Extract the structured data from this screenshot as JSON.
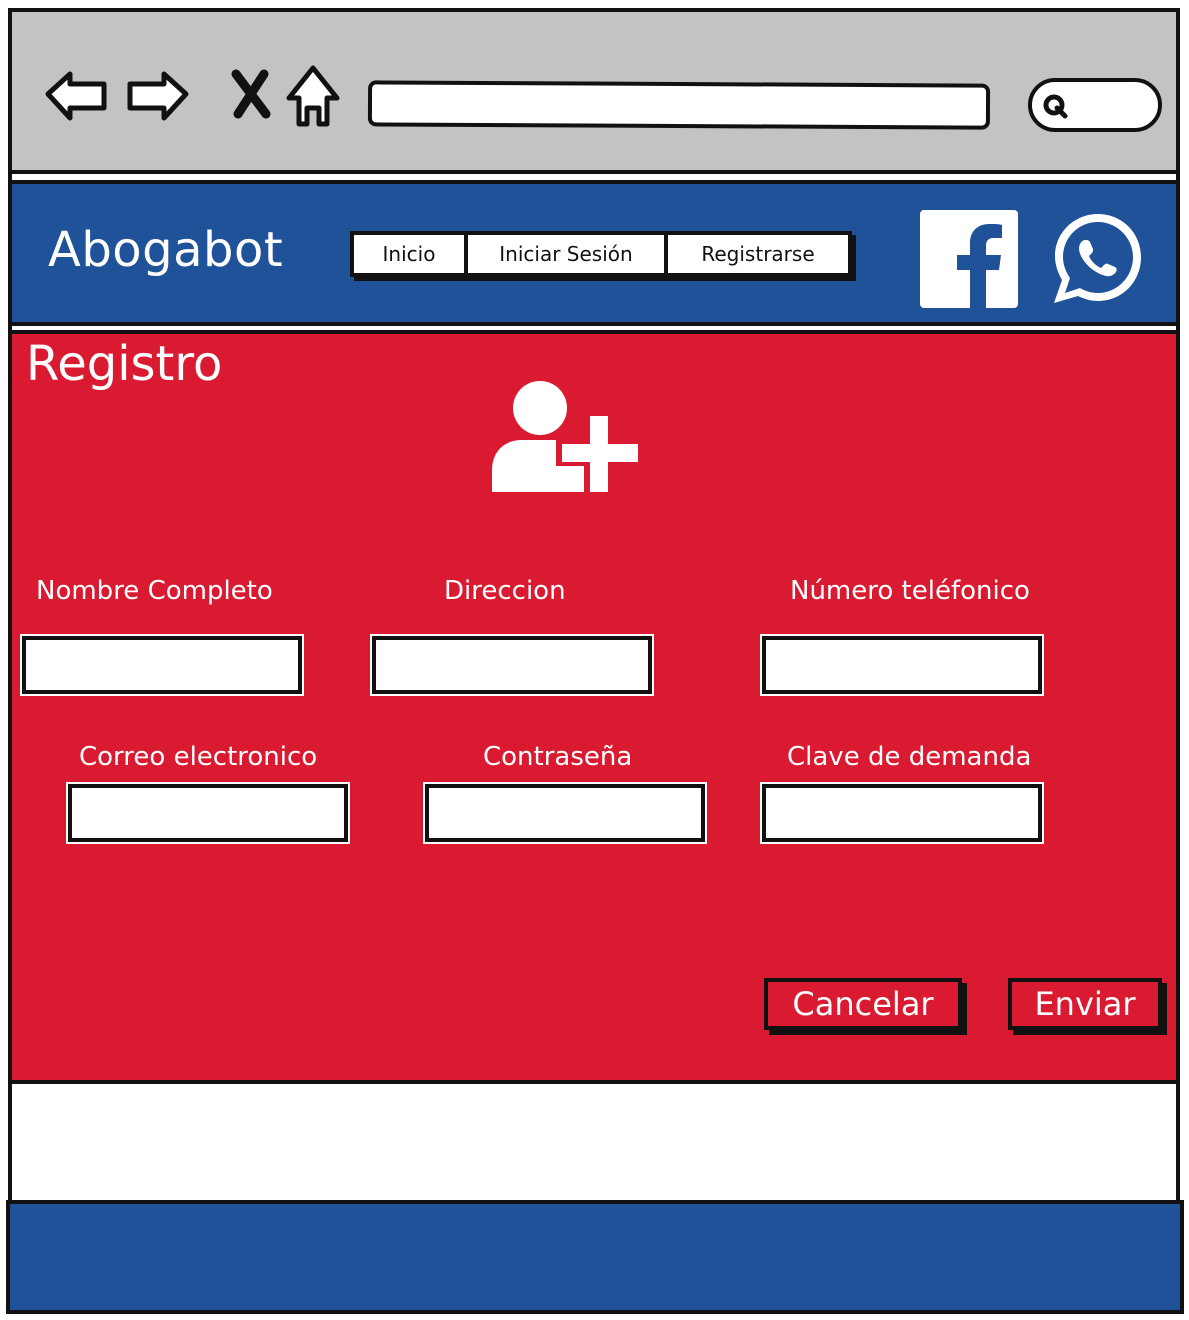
{
  "browser": {
    "icons": [
      "back-arrow-icon",
      "forward-arrow-icon",
      "close-icon",
      "home-icon",
      "search-icon"
    ],
    "address_value": "",
    "search_value": ""
  },
  "header": {
    "brand": "Abogabot",
    "menu": [
      {
        "label": "Inicio"
      },
      {
        "label": "Iniciar Sesión"
      },
      {
        "label": "Registrarse"
      }
    ],
    "social_icons": [
      "facebook-icon",
      "whatsapp-icon"
    ]
  },
  "main": {
    "title": "Registro",
    "icon": "user-add-icon",
    "fields": [
      {
        "label": "Nombre Completo",
        "value": ""
      },
      {
        "label": "Direccion",
        "value": ""
      },
      {
        "label": "Número teléfonico",
        "value": ""
      },
      {
        "label": "Correo electronico",
        "value": ""
      },
      {
        "label": "Contraseña",
        "value": ""
      },
      {
        "label": "Clave de demanda",
        "value": ""
      }
    ],
    "cancel_label": "Cancelar",
    "submit_label": "Enviar"
  },
  "colors": {
    "header_blue": "#1f5298",
    "main_red": "#da1a31",
    "chrome_gray": "#c3c3c3"
  }
}
